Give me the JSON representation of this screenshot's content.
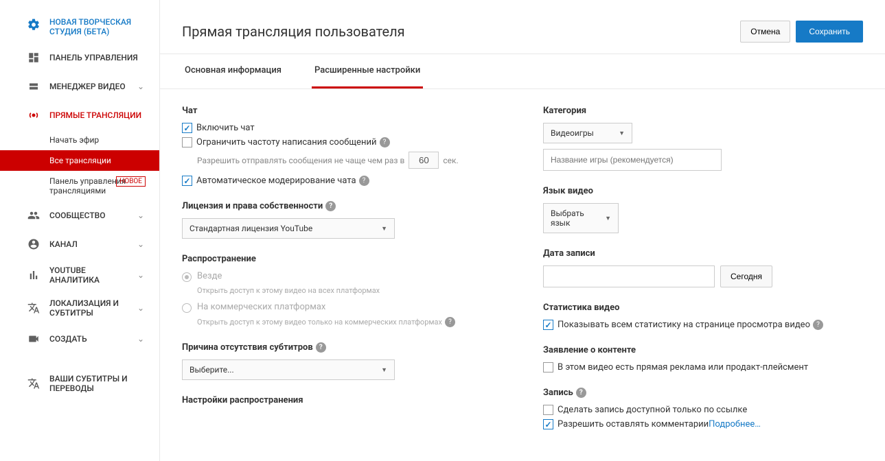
{
  "sidebar": {
    "studio": "НОВАЯ ТВОРЧЕСКАЯ СТУДИЯ (БЕТА)",
    "dashboard": "ПАНЕЛЬ УПРАВЛЕНИЯ",
    "video_manager": "МЕНЕДЖЕР ВИДЕО",
    "live": "ПРЯМЫЕ ТРАНСЛЯЦИИ",
    "live_start": "Начать эфир",
    "live_all": "Все трансляции",
    "live_panel": "Панель управления трансляциями",
    "live_badge": "НОВОЕ",
    "community": "СООБЩЕСТВО",
    "channel": "КАНАЛ",
    "analytics": "YOUTUBE АНАЛИТИКА",
    "localization": "ЛОКАЛИЗАЦИЯ И СУБТИТРЫ",
    "create": "СОЗДАТЬ",
    "captions": "ВАШИ СУБТИТРЫ И ПЕРЕВОДЫ"
  },
  "header": {
    "title": "Прямая трансляция пользователя",
    "cancel": "Отмена",
    "save": "Сохранить"
  },
  "tabs": {
    "basic": "Основная информация",
    "advanced": "Расширенные настройки"
  },
  "left": {
    "chat_title": "Чат",
    "enable_chat": "Включить чат",
    "limit_rate": "Ограничить частоту написания сообщений",
    "rate_prefix": "Разрешить отправлять сообщения не чаще чем раз в",
    "rate_value": "60",
    "rate_suffix": "сек.",
    "auto_moderate": "Автоматическое модерирование чата",
    "license_title": "Лицензия и права собственности",
    "license_value": "Стандартная лицензия YouTube",
    "dist_title": "Распространение",
    "dist_everywhere": "Везде",
    "dist_everywhere_desc": "Открыть доступ к этому видео на всех платформах",
    "dist_commercial": "На коммерческих платформах",
    "dist_commercial_desc": "Открыть доступ к этому видео только на коммерческих платформах",
    "caption_reason_title": "Причина отсутствия субтитров",
    "caption_reason_value": "Выберите...",
    "dist_settings_title": "Настройки распространения"
  },
  "right": {
    "category_title": "Категория",
    "category_value": "Видеоигры",
    "game_placeholder": "Название игры (рекомендуется)",
    "lang_title": "Язык видео",
    "lang_value": "Выбрать язык",
    "date_title": "Дата записи",
    "today": "Сегодня",
    "stats_title": "Статистика видео",
    "stats_public": "Показывать всем статистику на странице просмотра видео",
    "content_decl_title": "Заявление о контенте",
    "content_decl": "В этом видео есть прямая реклама или продакт-плейсмент",
    "record_title": "Запись",
    "record_link_only": "Сделать запись доступной только по ссылке",
    "allow_comments": "Разрешить оставлять комментарии",
    "learn_more": "Подробнее…"
  }
}
